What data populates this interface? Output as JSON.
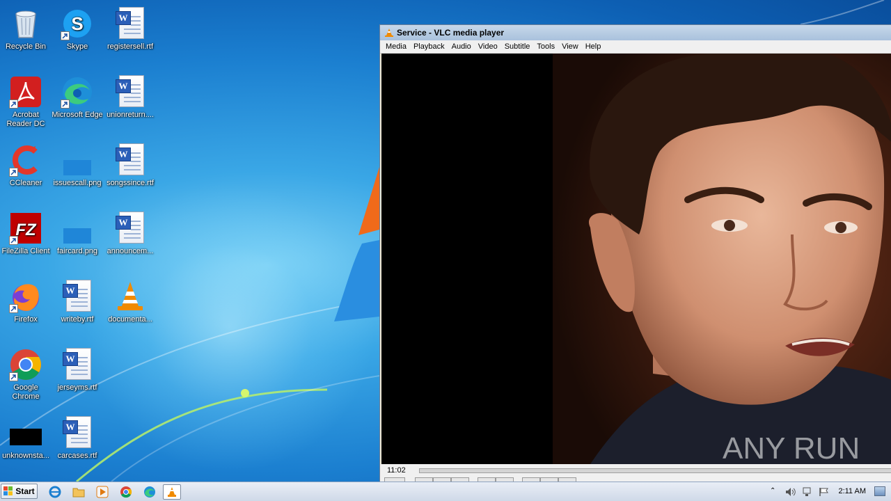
{
  "desktop": {
    "icons": [
      {
        "label": "Recycle Bin",
        "icon": "recycle-bin-icon"
      },
      {
        "label": "Skype",
        "icon": "skype-icon"
      },
      {
        "label": "registersell.rtf",
        "icon": "word-document-icon"
      },
      {
        "label": "Acrobat Reader DC",
        "icon": "acrobat-reader-icon"
      },
      {
        "label": "Microsoft Edge",
        "icon": "edge-icon"
      },
      {
        "label": "unionreturn....",
        "icon": "word-document-icon"
      },
      {
        "label": "CCleaner",
        "icon": "ccleaner-icon"
      },
      {
        "label": "issuescall.png",
        "icon": "png-image-icon"
      },
      {
        "label": "songssince.rtf",
        "icon": "word-document-icon"
      },
      {
        "label": "FileZilla Client",
        "icon": "filezilla-icon"
      },
      {
        "label": "faircard.png",
        "icon": "png-image-icon"
      },
      {
        "label": "announcem...",
        "icon": "word-document-icon"
      },
      {
        "label": "Firefox",
        "icon": "firefox-icon"
      },
      {
        "label": "writeby.rtf",
        "icon": "word-document-icon"
      },
      {
        "label": "documenta...",
        "icon": "vlc-cone-icon"
      },
      {
        "label": "Google Chrome",
        "icon": "chrome-icon"
      },
      {
        "label": "jerseyms.rtf",
        "icon": "word-document-icon"
      },
      {
        "label": "unknownsta...",
        "icon": "black-image-icon"
      },
      {
        "label": "carcases.rtf",
        "icon": "word-document-icon"
      }
    ]
  },
  "vlc": {
    "title": "Service - VLC media player",
    "menu": [
      "Media",
      "Playback",
      "Audio",
      "Video",
      "Subtitle",
      "Tools",
      "View",
      "Help"
    ],
    "time": "11:02",
    "watermark": "ANY RUN"
  },
  "taskbar": {
    "start_label": "Start",
    "pinned": [
      "internet-explorer-icon",
      "folder-icon",
      "media-player-icon",
      "chrome-icon",
      "edge-icon",
      "vlc-cone-icon"
    ],
    "clock": "2:11 AM"
  },
  "colors": {
    "desktop_blue": "#1b7fd0",
    "titlebar": "#b7cce4",
    "vlc_orange": "#f08a00"
  }
}
